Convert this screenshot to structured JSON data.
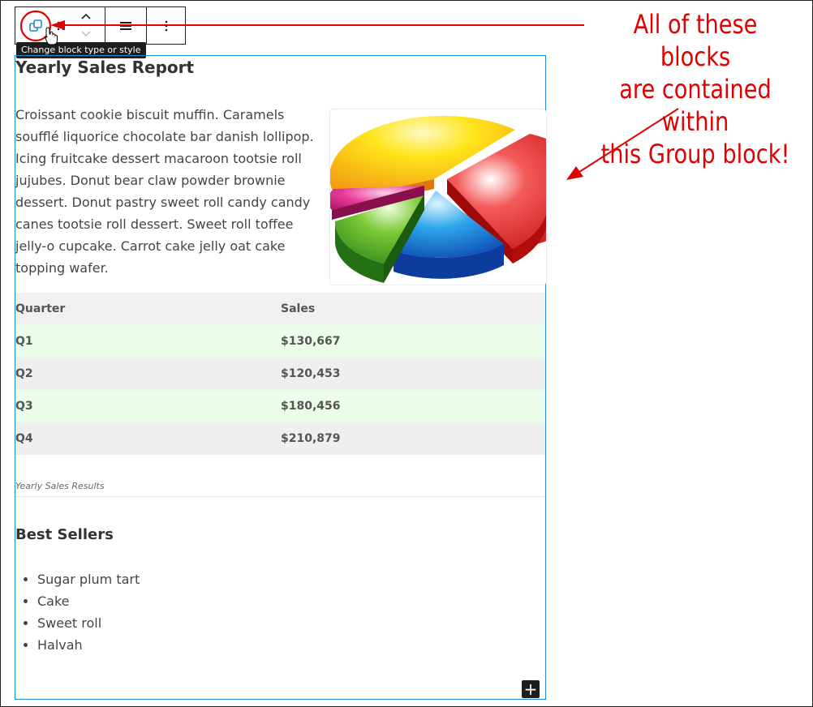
{
  "toolbar": {
    "tooltip": "Change block type or style",
    "icons": [
      "block-transform-icon",
      "drag-handle-icon",
      "move-up-icon",
      "move-down-icon",
      "align-icon",
      "more-options-icon"
    ]
  },
  "content": {
    "title": "Yearly Sales Report",
    "paragraph": "Croissant cookie biscuit muffin. Caramels soufflé liquorice chocolate bar danish lollipop. Icing fruitcake dessert macaroon tootsie roll jujubes. Donut bear claw powder brownie dessert. Donut pastry sweet roll candy candy canes tootsie roll dessert. Sweet roll toffee jelly-o cupcake. Carrot cake jelly oat cake topping wafer."
  },
  "table": {
    "headers": [
      "Quarter",
      "Sales"
    ],
    "rows": [
      [
        "Q1",
        "$130,667"
      ],
      [
        "Q2",
        "$120,453"
      ],
      [
        "Q3",
        "$180,456"
      ],
      [
        "Q4",
        "$210,879"
      ]
    ],
    "caption": "Yearly Sales Results"
  },
  "best_sellers": {
    "heading": "Best Sellers",
    "items": [
      "Sugar plum tart",
      "Cake",
      "Sweet roll",
      "Halvah"
    ]
  },
  "add_block": "+",
  "annotation": {
    "line1": "All of these blocks",
    "line2": "are contained within",
    "line3": "this Group block!"
  },
  "colors": {
    "accent": "#1b8ad3",
    "annotation": "#e00000",
    "toolbar_dark": "#1e1e1e",
    "row_green": "#ebfcea",
    "row_gray": "#efefef"
  }
}
